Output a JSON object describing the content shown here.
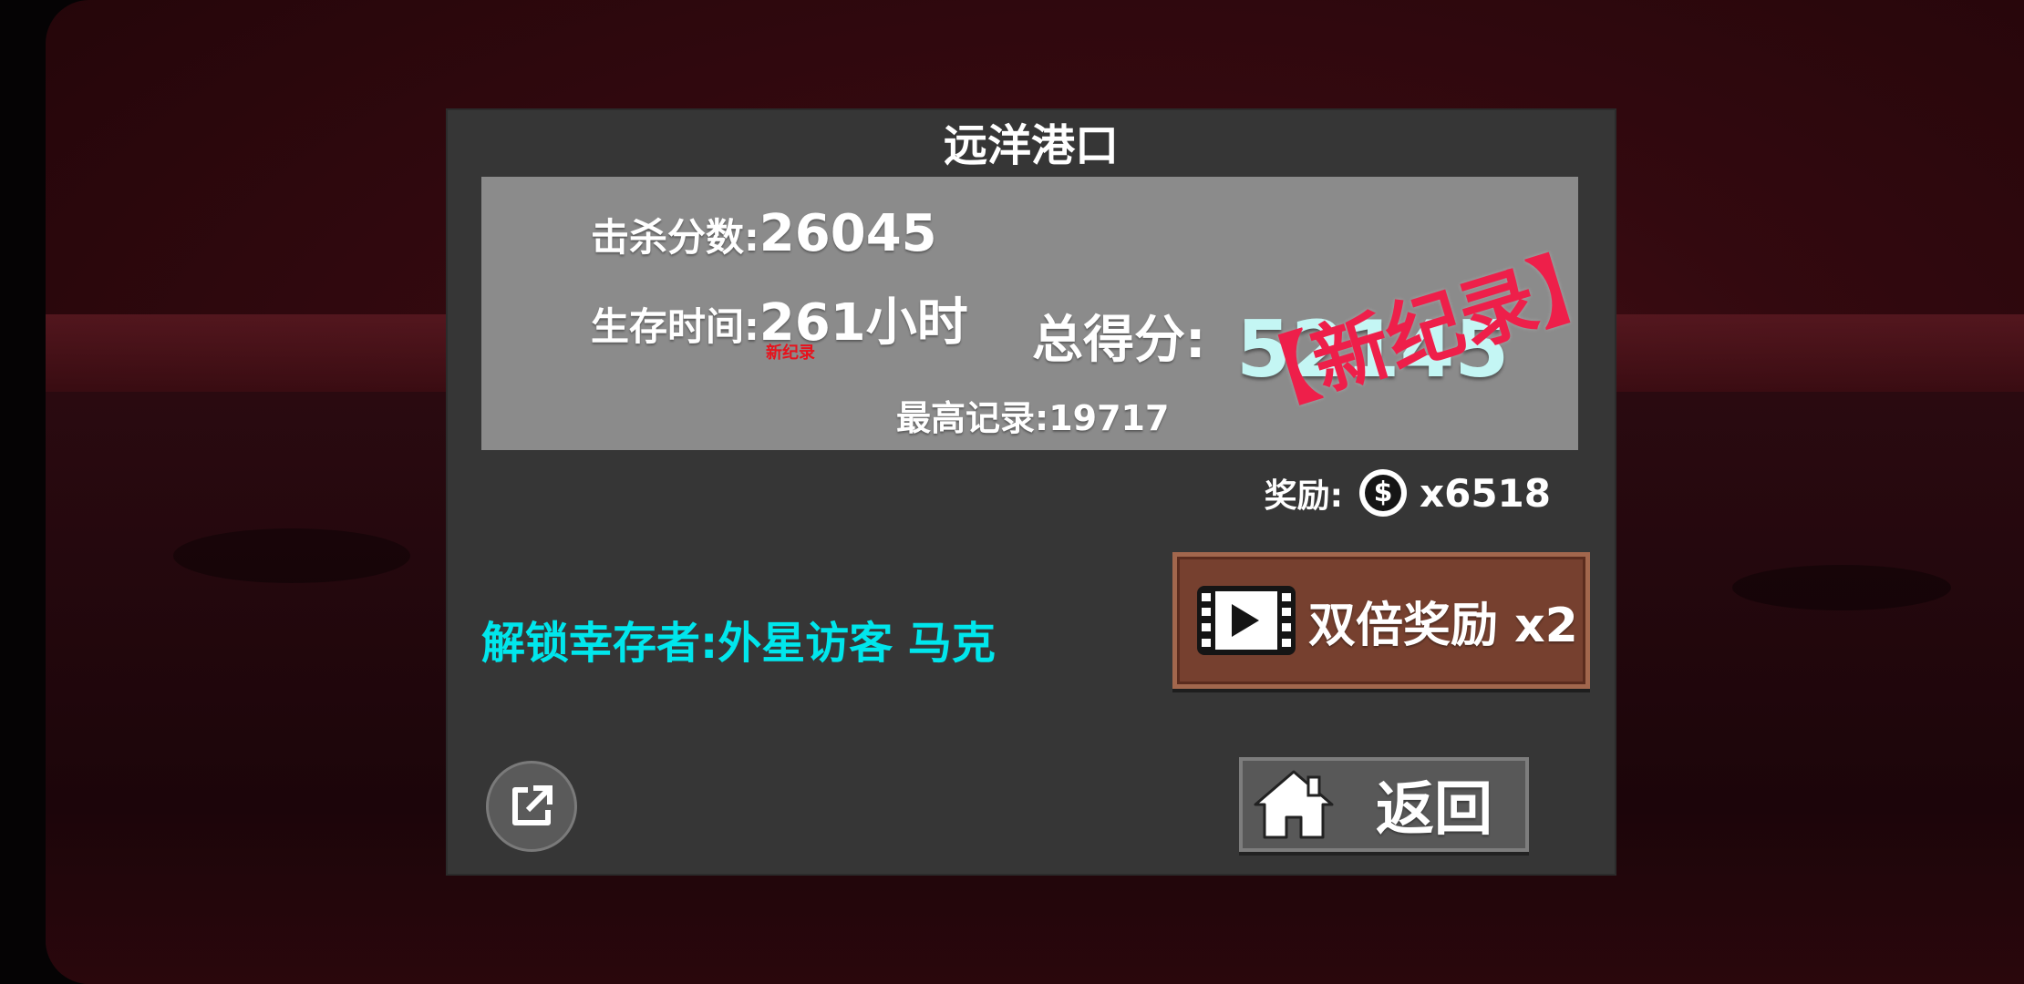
{
  "level": {
    "title": "远洋港口"
  },
  "stats": {
    "kill_label": "击杀分数:",
    "kill_value": "26045",
    "time_label": "生存时间:",
    "time_value": "261小时",
    "time_new_record": "新纪录",
    "total_label": "总得分:",
    "total_value": "52145",
    "new_record_stamp": "【新纪录】",
    "best_label": "最高记录:",
    "best_value": "19717"
  },
  "reward": {
    "label": "奖励:",
    "coin_symbol": "$",
    "amount": "x6518"
  },
  "unlock_text": "解锁幸存者:外星访客 马克",
  "buttons": {
    "double_reward": "双倍奖励 x2",
    "back": "返回"
  },
  "icons": {
    "share": "share-external-icon",
    "video": "video-ad-icon",
    "home": "home-icon",
    "coin": "coin-icon"
  },
  "colors": {
    "panel": "#363636",
    "score_box": "#8b8b8b",
    "total_value": "#c4f6f4",
    "stamp": "#ee1f4a",
    "unlock_text": "#00e6ec",
    "double_button": "#76402f",
    "back_button": "#585858"
  }
}
